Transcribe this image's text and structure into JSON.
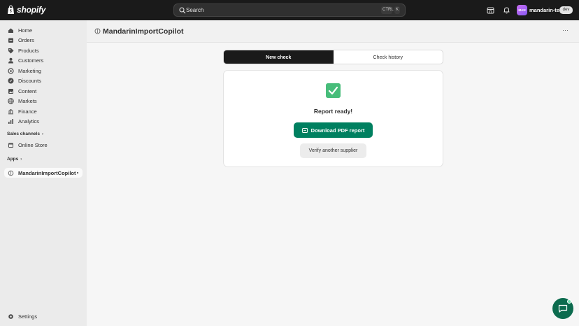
{
  "topbar": {
    "logo_text": "shopify",
    "search_label": "Search",
    "kbd_ctrl": "CTRL",
    "kbd_k": "K",
    "avatar_initials": "MAN",
    "store_name": "mandarin-test",
    "store_badge": "dev"
  },
  "sidebar": {
    "items": [
      {
        "label": "Home",
        "icon": "home-icon"
      },
      {
        "label": "Orders",
        "icon": "orders-icon"
      },
      {
        "label": "Products",
        "icon": "tag-icon"
      },
      {
        "label": "Customers",
        "icon": "person-icon"
      },
      {
        "label": "Marketing",
        "icon": "target-icon"
      },
      {
        "label": "Discounts",
        "icon": "discount-icon"
      },
      {
        "label": "Content",
        "icon": "image-icon"
      },
      {
        "label": "Markets",
        "icon": "globe-icon"
      },
      {
        "label": "Finance",
        "icon": "bank-icon"
      },
      {
        "label": "Analytics",
        "icon": "chart-icon"
      }
    ],
    "sales_channels_title": "Sales channels",
    "online_store_label": "Online Store",
    "apps_title": "Apps",
    "app_item_label": "MandarinImportCopilot",
    "settings_label": "Settings"
  },
  "main": {
    "app_title": "MandarinImportCopilot",
    "more_label": "⋯",
    "tabs": [
      {
        "label": "New check",
        "active": true
      },
      {
        "label": "Check history",
        "active": false
      }
    ],
    "card": {
      "title": "Report ready!",
      "primary_button": "Download PDF report",
      "secondary_button": "Verify another supplier"
    }
  },
  "colors": {
    "accent": "#008060",
    "success": "#47bd7a",
    "topbar": "#1a1a1a"
  }
}
